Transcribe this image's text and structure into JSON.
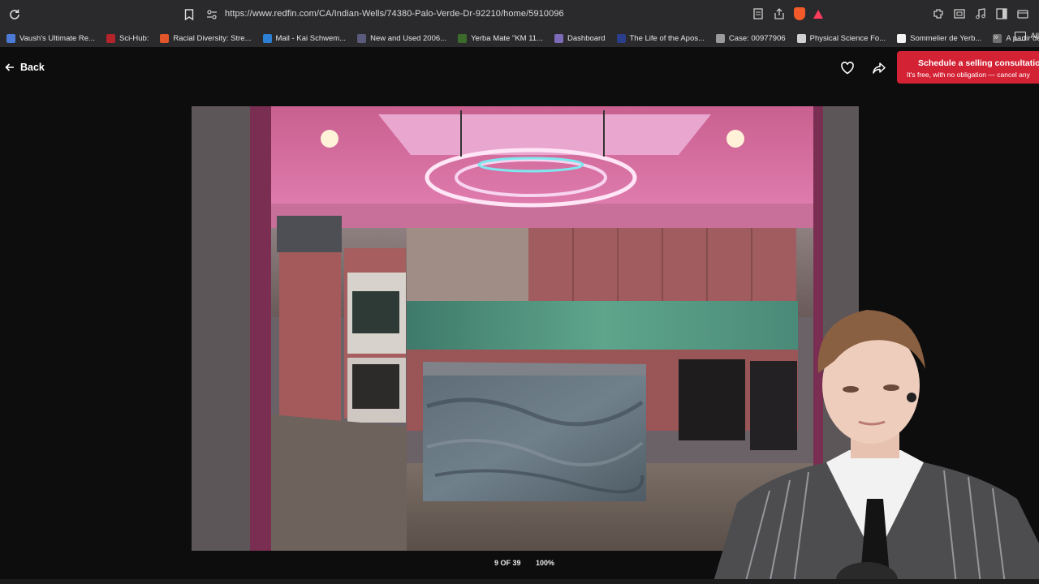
{
  "browser": {
    "url": "https://www.redfin.com/CA/Indian-Wells/74380-Palo-Verde-Dr-92210/home/5910096",
    "bookmarks": [
      {
        "label": "Vaush's Ultimate Re...",
        "color": "#4b7bd6"
      },
      {
        "label": "Sci-Hub:",
        "color": "#b3242b"
      },
      {
        "label": "Racial Diversity: Stre...",
        "color": "#e2562b"
      },
      {
        "label": "Mail - Kai Schwem...",
        "color": "#2d7fd3"
      },
      {
        "label": "New and Used 2006...",
        "color": "#5a5a7a"
      },
      {
        "label": "Yerba Mate \"KM 11...",
        "color": "#3d6b2b"
      },
      {
        "label": "Dashboard",
        "color": "#7d6ab8"
      },
      {
        "label": "The Life of the Apos...",
        "color": "#2b3e8e"
      },
      {
        "label": "Case: 00977906",
        "color": "#9a9a9a"
      },
      {
        "label": "Physical Science Fo...",
        "color": "#d0d0d0"
      },
      {
        "label": "Sommelier de Yerb...",
        "color": "#f2f2f2"
      },
      {
        "label": "A partir de agosto A...",
        "color": "#6f6f6f"
      }
    ],
    "all_bookmarks_label": "All"
  },
  "header": {
    "back_label": "Back",
    "cta_title": "Schedule a selling consultation",
    "cta_subtitle": "It's free, with no obligation — cancel any"
  },
  "viewer": {
    "counter": "9 OF 39",
    "zoom": "100%"
  },
  "colors": {
    "cta": "#d42235",
    "page_bg": "#0d0d0d"
  }
}
